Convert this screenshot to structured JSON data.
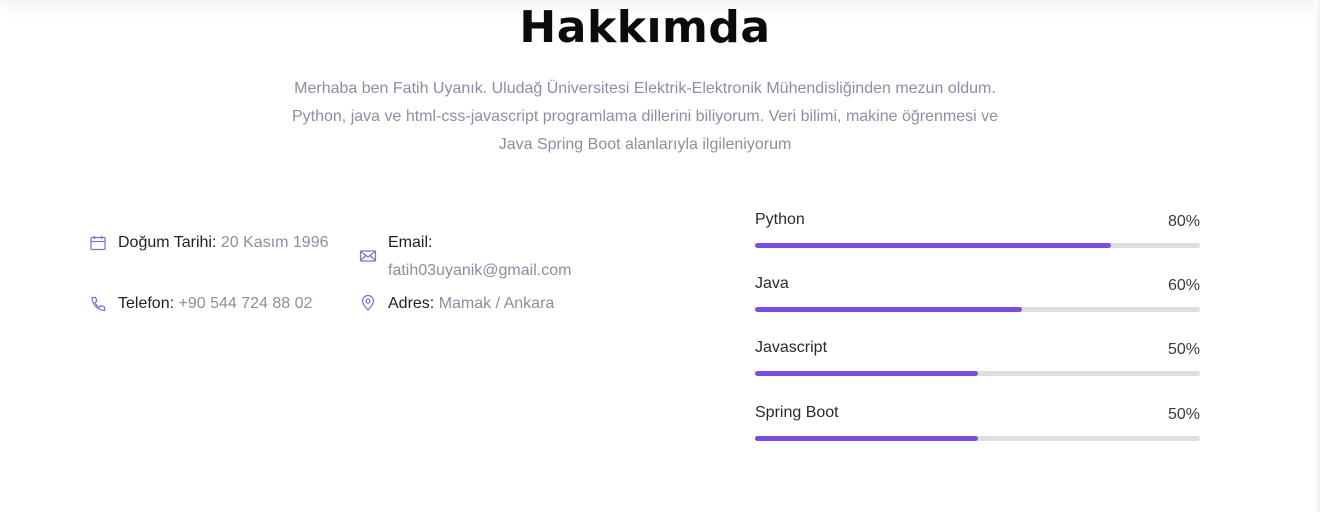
{
  "about": {
    "title": "Hakkımda",
    "intro": "Merhaba ben Fatih Uyanık. Uludağ Üniversitesi Elektrik-Elektronik Mühendisliğinden mezun oldum. Python, java ve html-css-javascript programlama dillerini biliyorum. Veri bilimi, makine öğrenmesi ve Java Spring Boot alanlarıyla ilgileniyorum"
  },
  "info": {
    "birthdate": {
      "label": "Doğum Tarihi:",
      "value": "20 Kasım 1996",
      "icon": "calendar-icon"
    },
    "email": {
      "label": "Email:",
      "value": "fatih03uyanik@gmail.com",
      "icon": "envelope-icon"
    },
    "phone": {
      "label": "Telefon:",
      "value": "+90 544 724 88 02",
      "icon": "phone-icon"
    },
    "address": {
      "label": "Adres:",
      "value": "Mamak / Ankara",
      "icon": "map-pin-icon"
    }
  },
  "skills": [
    {
      "name": "Python",
      "percent_label": "80%",
      "level": 0.8
    },
    {
      "name": "Java",
      "percent_label": "60%",
      "level": 0.6
    },
    {
      "name": "Javascript",
      "percent_label": "50%",
      "level": 0.5
    },
    {
      "name": "Spring Boot",
      "percent_label": "50%",
      "level": 0.5
    }
  ],
  "colors": {
    "accent": "#7b4ce3",
    "track": "#dedede",
    "muted_text": "#8a8fa3",
    "heading": "#0b0b0b"
  }
}
